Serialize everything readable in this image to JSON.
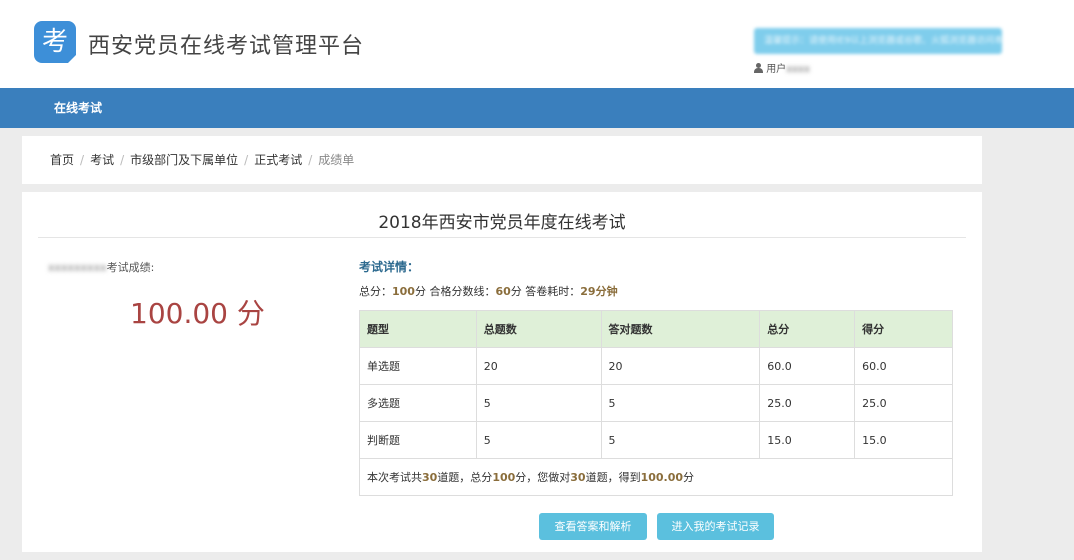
{
  "header": {
    "logo_char": "考",
    "site_title": "西安党员在线考试管理平台",
    "notice": "温馨提示：请使用IE9以上浏览器或谷歌、火狐浏览器访问本系统",
    "user_prefix": "用户",
    "user_name": "xxxx"
  },
  "nav": {
    "items": [
      {
        "label": "在线考试"
      }
    ]
  },
  "breadcrumb": {
    "items": [
      "首页",
      "考试",
      "市级部门及下属单位",
      "正式考试"
    ],
    "current": "成绩单",
    "separator": "/"
  },
  "exam": {
    "title": "2018年西安市党员年度在线考试",
    "score_label_name": "xxxxxxxxx",
    "score_label": "考试成绩:",
    "score_value": "100.00",
    "score_unit": "分",
    "details_heading": "考试详情：",
    "total_label": "总分：",
    "total_value": "100",
    "total_unit": "分",
    "pass_label": "合格分数线：",
    "pass_value": "60",
    "pass_unit": "分",
    "time_label": "答卷耗时：",
    "time_value": "29分钟"
  },
  "table": {
    "headers": [
      "题型",
      "总题数",
      "答对题数",
      "总分",
      "得分"
    ],
    "rows": [
      [
        "单选题",
        "20",
        "20",
        "60.0",
        "60.0"
      ],
      [
        "多选题",
        "5",
        "5",
        "25.0",
        "25.0"
      ],
      [
        "判断题",
        "5",
        "5",
        "15.0",
        "15.0"
      ]
    ],
    "summary": {
      "p1": "本次考试共",
      "count": "30",
      "p2": "道题，总分",
      "total": "100",
      "p3": "分，您做对",
      "correct": "30",
      "p4": "道题，得到",
      "score": "100.00",
      "p5": "分"
    }
  },
  "buttons": {
    "answers": "查看答案和解析",
    "records": "进入我的考试记录"
  },
  "colors": {
    "nav_bg": "#3a7fbd",
    "score_red": "#a94442",
    "accent_brown": "#8a6d3b",
    "table_head": "#dff0d8",
    "button": "#5bc0de"
  }
}
